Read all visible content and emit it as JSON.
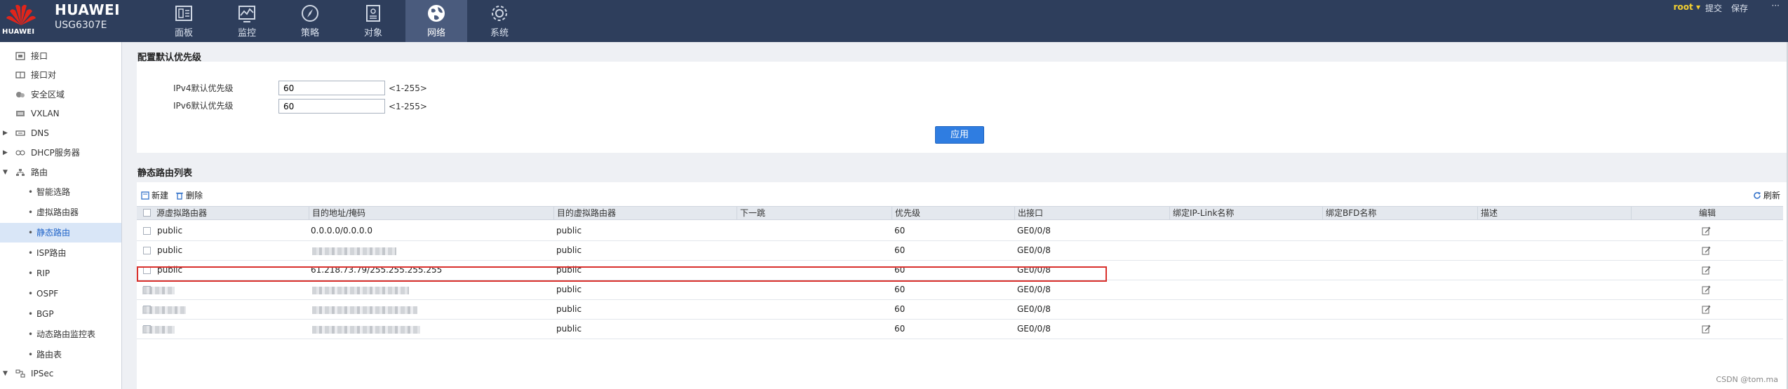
{
  "header": {
    "logo_text": "HUAWEI",
    "brand": "HUAWEI",
    "model": "USG6307E",
    "nav": [
      {
        "label": "面板",
        "icon": "dashboard-icon",
        "active": false
      },
      {
        "label": "监控",
        "icon": "monitor-icon",
        "active": false
      },
      {
        "label": "策略",
        "icon": "compass-icon",
        "active": false
      },
      {
        "label": "对象",
        "icon": "object-icon",
        "active": false
      },
      {
        "label": "网络",
        "icon": "globe-icon",
        "active": true
      },
      {
        "label": "系统",
        "icon": "gear-icon",
        "active": false
      }
    ],
    "user": "root",
    "commit": "提交",
    "save": "保存",
    "more": "···"
  },
  "sidebar": {
    "items": [
      {
        "label": "接口",
        "icon": "interface-icon"
      },
      {
        "label": "接口对",
        "icon": "interface-pair-icon"
      },
      {
        "label": "安全区域",
        "icon": "security-zone-icon"
      },
      {
        "label": "VXLAN",
        "icon": "vxlan-icon"
      },
      {
        "label": "DNS",
        "icon": "dns-icon",
        "expand": "collapsed"
      },
      {
        "label": "DHCP服务器",
        "icon": "dhcp-icon",
        "expand": "collapsed"
      },
      {
        "label": "路由",
        "icon": "route-icon",
        "expand": "expanded"
      },
      {
        "label": "智能选路",
        "sub": true
      },
      {
        "label": "虚拟路由器",
        "sub": true
      },
      {
        "label": "静态路由",
        "sub": true,
        "active": true
      },
      {
        "label": "ISP路由",
        "sub": true
      },
      {
        "label": "RIP",
        "sub": true
      },
      {
        "label": "OSPF",
        "sub": true
      },
      {
        "label": "BGP",
        "sub": true
      },
      {
        "label": "动态路由监控表",
        "sub": true
      },
      {
        "label": "路由表",
        "sub": true
      },
      {
        "label": "IPSec",
        "icon": "ipsec-icon",
        "expand": "expanded"
      }
    ]
  },
  "priority_section": {
    "title": "配置默认优先级",
    "ipv4_label": "IPv4默认优先级",
    "ipv4_value": "60",
    "ipv6_label": "IPv6默认优先级",
    "ipv6_value": "60",
    "range_hint": "<1-255>",
    "apply_label": "应用"
  },
  "routes_section": {
    "title": "静态路由列表",
    "new_label": "新建",
    "delete_label": "删除",
    "refresh_label": "刷新",
    "columns": [
      "源虚拟路由器",
      "目的地址/掩码",
      "目的虚拟路由器",
      "下一跳",
      "优先级",
      "出接口",
      "绑定IP-Link名称",
      "绑定BFD名称",
      "描述",
      "编辑"
    ],
    "rows": [
      {
        "src": "public",
        "dest": "0.0.0.0/0.0.0.0",
        "dst_vr": "public",
        "next_hop": "",
        "priority": "60",
        "out_if": "GE0/0/8",
        "src_masked": false,
        "dest_masked": false,
        "highlighted": false
      },
      {
        "src": "public",
        "dest": "",
        "dst_vr": "public",
        "next_hop": "",
        "priority": "60",
        "out_if": "GE0/0/8",
        "src_masked": false,
        "dest_masked": true,
        "highlighted": false
      },
      {
        "src": "public",
        "dest": "61.218.73.79/255.255.255.255",
        "dst_vr": "public",
        "next_hop": "",
        "priority": "60",
        "out_if": "GE0/0/8",
        "src_masked": false,
        "dest_masked": false,
        "highlighted": true
      },
      {
        "src": "",
        "dest": "",
        "dst_vr": "public",
        "next_hop": "",
        "priority": "60",
        "out_if": "GE0/0/8",
        "src_masked": true,
        "dest_masked": true,
        "highlighted": false
      },
      {
        "src": "",
        "dest": "",
        "dst_vr": "public",
        "next_hop": "",
        "priority": "60",
        "out_if": "GE0/0/8",
        "src_masked": true,
        "dest_masked": true,
        "highlighted": false
      },
      {
        "src": "",
        "dest": "",
        "dst_vr": "public",
        "next_hop": "",
        "priority": "60",
        "out_if": "GE0/0/8",
        "src_masked": true,
        "dest_masked": true,
        "highlighted": false
      }
    ]
  },
  "watermark": "CSDN @tom.ma",
  "colors": {
    "topbar": "#2e3e5c",
    "active_tab": "#4a5b7d",
    "apply_button": "#2f7de1",
    "highlight_border": "#d9302c",
    "sidebar_active": "#d9e6f7"
  }
}
